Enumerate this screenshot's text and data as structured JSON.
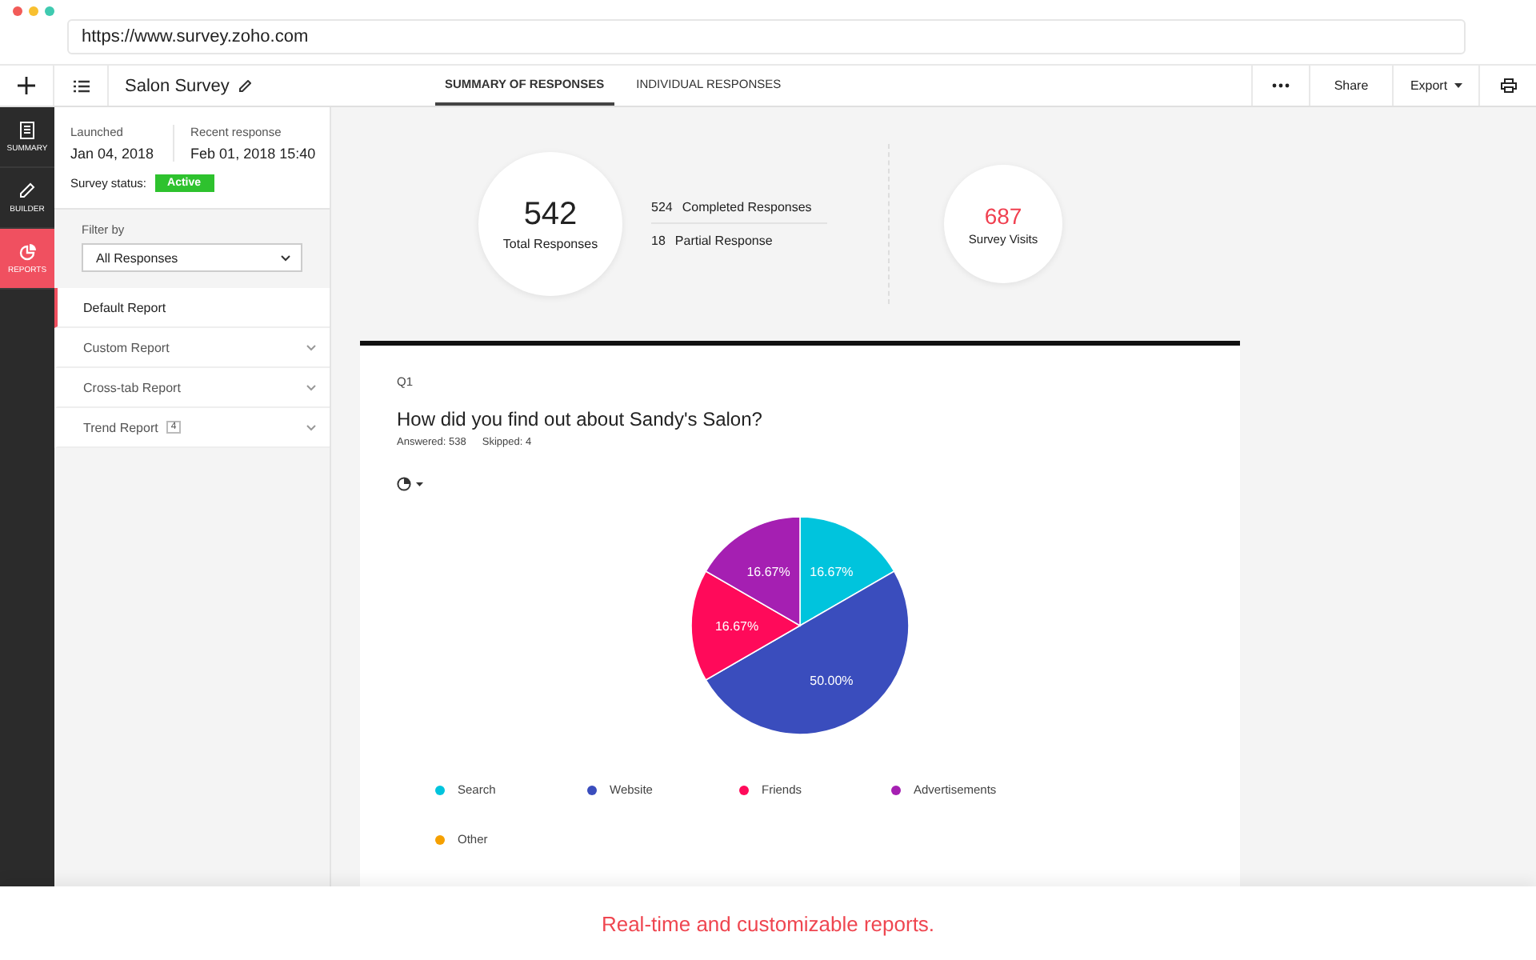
{
  "browser": {
    "url": "https://www.survey.zoho.com"
  },
  "header": {
    "title": "Salon Survey",
    "tabs": [
      {
        "label": "SUMMARY OF RESPONSES",
        "selected": true
      },
      {
        "label": "INDIVIDUAL RESPONSES",
        "selected": false
      }
    ],
    "actions": [
      {
        "label": "Share",
        "kind": "button"
      },
      {
        "label": "Export",
        "kind": "dropdown"
      }
    ]
  },
  "rail": [
    {
      "label": "SUMMARY",
      "kind": "summary",
      "selected": false
    },
    {
      "label": "BUILDER",
      "kind": "builder",
      "selected": false
    },
    {
      "label": "REPORTS",
      "kind": "reports",
      "selected": true
    }
  ],
  "info": {
    "launched_label": "Launched",
    "launched": "Jan 04, 2018",
    "recent_label": "Recent response",
    "recent": "Feb 01, 2018 15:40",
    "status_label": "Survey status:",
    "status": "Active"
  },
  "filter": {
    "label": "Filter by",
    "value": "All Responses"
  },
  "reports": [
    {
      "label": "Default Report",
      "selected": true,
      "expandable": false
    },
    {
      "label": "Custom Report",
      "selected": false,
      "expandable": true
    },
    {
      "label": "Cross-tab Report",
      "selected": false,
      "expandable": true
    },
    {
      "label": "Trend Report",
      "selected": false,
      "expandable": true,
      "count": "4"
    }
  ],
  "stats": {
    "total": "542",
    "total_label": "Total Responses",
    "completed": "524",
    "completed_label": "Completed Responses",
    "partial": "18",
    "partial_label": "Partial Response",
    "visits": "687",
    "visits_label": "Survey Visits"
  },
  "question": {
    "number": "Q1",
    "text": "How did you find out about Sandy's Salon?",
    "answered": "Answered: 538",
    "skipped": "Skipped: 4",
    "chart_data": {
      "type": "pie",
      "categories": [
        "Search",
        "Website",
        "Friends",
        "Advertisements",
        "Other"
      ],
      "values": [
        16.67,
        50,
        16.67,
        16.67,
        0
      ],
      "value_labels": [
        "16.67%",
        "50.00%",
        "16.67%",
        "16.67%",
        null
      ]
    },
    "legend": [
      {
        "color": "#00c4dd"
      },
      {
        "color": "#3a4dbd"
      },
      {
        "color": "#ff0a5a"
      },
      {
        "color": "#a51fb2"
      },
      {
        "color": "#f5a000"
      }
    ]
  },
  "caption": "Real-time and customizable reports."
}
